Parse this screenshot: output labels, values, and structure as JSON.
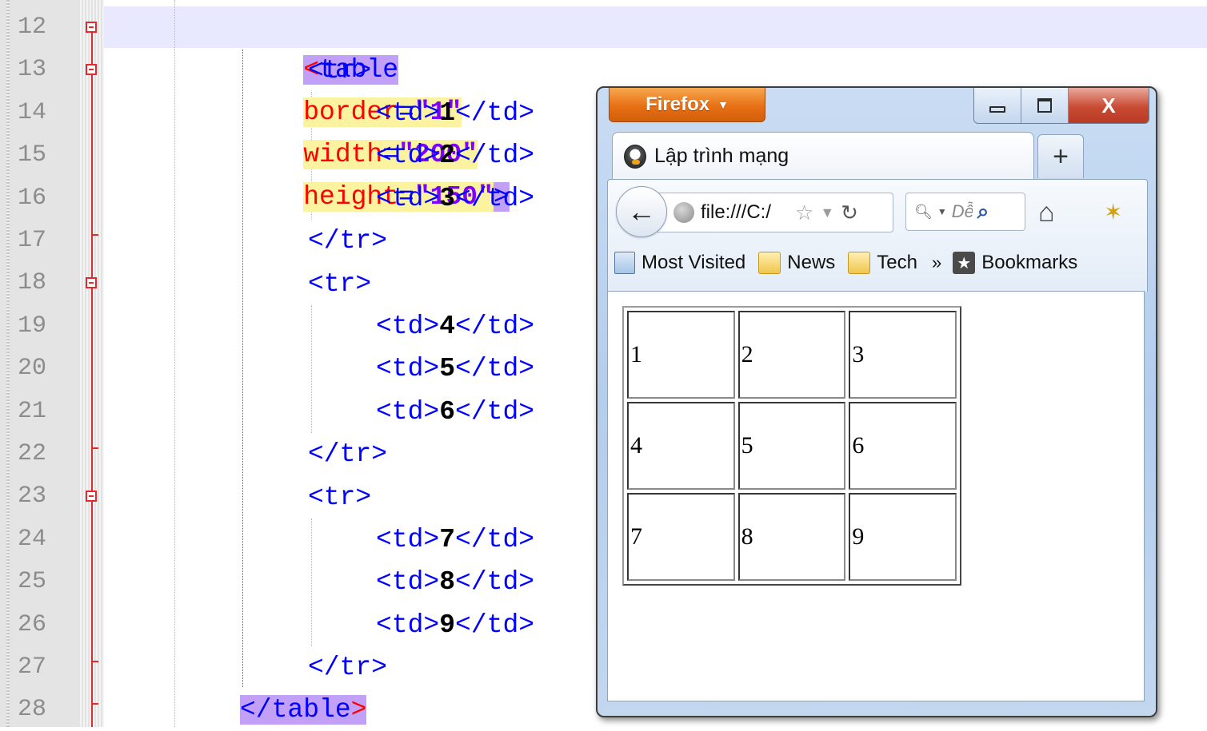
{
  "editor": {
    "line_numbers": [
      "12",
      "13",
      "14",
      "15",
      "16",
      "17",
      "18",
      "19",
      "20",
      "21",
      "22",
      "23",
      "24",
      "25",
      "26",
      "27",
      "28"
    ],
    "lines": [
      {
        "open_bracket": "<",
        "tag": "table",
        "close_bracket": ">",
        "attrs": [
          {
            "name": "border",
            "eq": "=",
            "value": "\"1\""
          },
          {
            "name": "width",
            "eq": "=",
            "value": "\"200\""
          },
          {
            "name": "height",
            "eq": "=",
            "value": "\"150\""
          }
        ]
      },
      {
        "text": "<tr>"
      },
      {
        "pre": "<td>",
        "val": "1",
        "post": "</td>"
      },
      {
        "pre": "<td>",
        "val": "2",
        "post": "</td>"
      },
      {
        "pre": "<td>",
        "val": "3",
        "post": "</td>"
      },
      {
        "text": "</tr>"
      },
      {
        "text": "<tr>"
      },
      {
        "pre": "<td>",
        "val": "4",
        "post": "</td>"
      },
      {
        "pre": "<td>",
        "val": "5",
        "post": "</td>"
      },
      {
        "pre": "<td>",
        "val": "6",
        "post": "</td>"
      },
      {
        "text": "</tr>"
      },
      {
        "text": "<tr>"
      },
      {
        "pre": "<td>",
        "val": "7",
        "post": "</td>"
      },
      {
        "pre": "<td>",
        "val": "8",
        "post": "</td>"
      },
      {
        "pre": "<td>",
        "val": "9",
        "post": "</td>"
      },
      {
        "text": "</tr>"
      },
      {
        "close": "</table",
        "close_bracket": ">"
      }
    ]
  },
  "firefox": {
    "menu_label": "Firefox",
    "menu_arrow": "▼",
    "close_glyph": "X",
    "tab_title": "Lập trình mạng",
    "new_tab": "+",
    "url_text": "file:///C:/",
    "search_placeholder": "Dễ",
    "bookmarks": {
      "most_visited": "Most Visited",
      "news": "News",
      "tech": "Tech",
      "chevron": "»",
      "bookmarks": "Bookmarks"
    },
    "table_cells": [
      [
        "1",
        "2",
        "3"
      ],
      [
        "4",
        "5",
        "6"
      ],
      [
        "7",
        "8",
        "9"
      ]
    ]
  },
  "colors": {
    "tag_blue": "#0000ff",
    "attr_red": "#ff0000",
    "value_purple": "#8000ff",
    "tag_highlight": "#c2a0f8",
    "attr_highlight": "#fcf3a0",
    "firefox_orange": "#e86f14"
  },
  "icons": [
    "fold-collapse-icon",
    "globe-icon",
    "star-icon",
    "dropdown-icon",
    "reload-icon",
    "search-icon",
    "home-icon",
    "addon-icon",
    "back-arrow-icon",
    "folder-icon",
    "bookmarks-star-icon"
  ]
}
